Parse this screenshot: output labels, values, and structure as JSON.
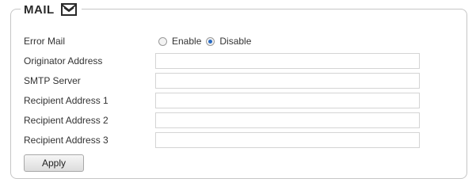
{
  "section": {
    "title": "MAIL",
    "icon": "mail-icon"
  },
  "error_mail": {
    "label": "Error Mail",
    "options": [
      {
        "label": "Enable",
        "checked": false
      },
      {
        "label": "Disable",
        "checked": true
      }
    ]
  },
  "fields": [
    {
      "label": "Originator Address",
      "value": ""
    },
    {
      "label": "SMTP Server",
      "value": ""
    },
    {
      "label": "Recipient Address 1",
      "value": ""
    },
    {
      "label": "Recipient Address 2",
      "value": ""
    },
    {
      "label": "Recipient Address 3",
      "value": ""
    }
  ],
  "apply_label": "Apply",
  "colors": {
    "border": "#c6c6c6",
    "radio_selected": "#2a6bc2"
  }
}
